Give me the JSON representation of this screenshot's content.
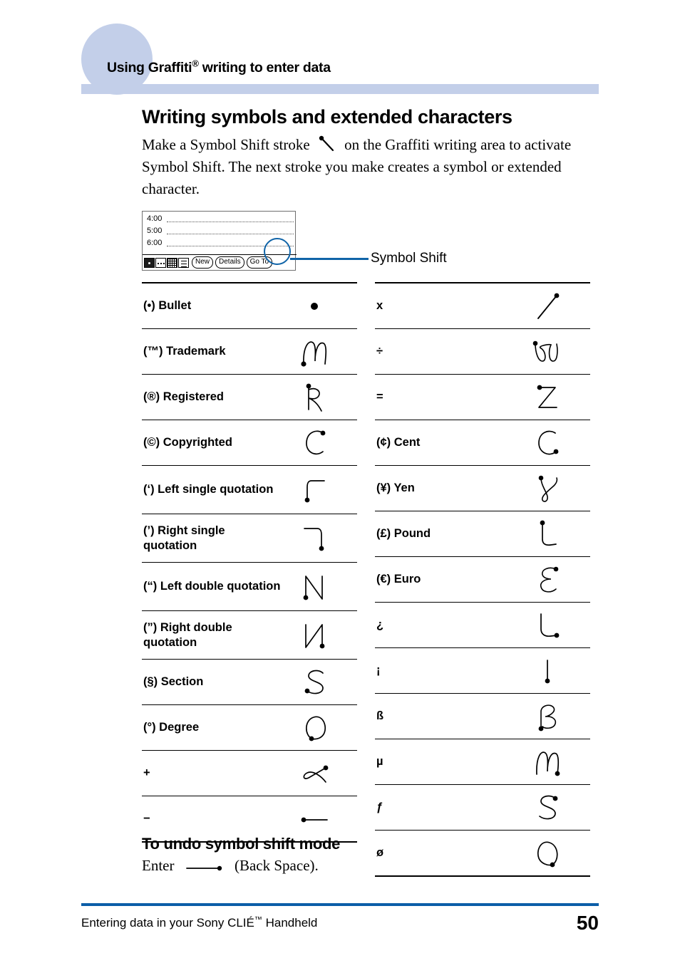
{
  "header": {
    "running_head_prefix": "Using Graffiti",
    "running_head_sup": "®",
    "running_head_suffix": " writing to enter data",
    "bar_color": "#c3cfe9"
  },
  "main": {
    "section_title": "Writing symbols and extended characters",
    "body_part1": "Make a Symbol Shift stroke",
    "body_part2": "on the Graffiti writing area to activate Symbol Shift. The next stroke you make creates a symbol or extended character."
  },
  "figure": {
    "times": [
      "4:00",
      "5:00",
      "6:00"
    ],
    "buttons": [
      "New",
      "Details",
      "Go To"
    ],
    "callout_label": "Symbol Shift",
    "callout_color": "#1064a8"
  },
  "symbol_table": {
    "left_column": [
      {
        "label": "(•) Bullet",
        "stroke": "bullet",
        "lines": 1
      },
      {
        "label": "(™) Trademark",
        "stroke": "trademark-m",
        "lines": 1
      },
      {
        "label": "(®) Registered",
        "stroke": "registered-r",
        "lines": 1
      },
      {
        "label": "(©) Copyrighted",
        "stroke": "copyright-c",
        "lines": 1
      },
      {
        "label": "(‘) Left single quotation",
        "stroke": "left-single-quote",
        "lines": 2
      },
      {
        "label": "(’) Right single quotation",
        "stroke": "right-single-quote",
        "lines": 2
      },
      {
        "label": "(“) Left double quotation",
        "stroke": "left-double-quote",
        "lines": 2
      },
      {
        "label": "(”) Right double quotation",
        "stroke": "right-double-quote",
        "lines": 2
      },
      {
        "label": "(§) Section",
        "stroke": "section-s",
        "lines": 1
      },
      {
        "label": "(°) Degree",
        "stroke": "degree-o",
        "lines": 1
      },
      {
        "label": "+",
        "stroke": "plus-loop",
        "lines": 1
      },
      {
        "label": "−",
        "stroke": "minus-line",
        "lines": 1
      }
    ],
    "right_column": [
      {
        "label": "x",
        "stroke": "times-slash",
        "lines": 1
      },
      {
        "label": "÷",
        "stroke": "divide-w",
        "lines": 1
      },
      {
        "label": "=",
        "stroke": "equals-z",
        "lines": 1
      },
      {
        "label": "(¢) Cent",
        "stroke": "cent-c",
        "lines": 1
      },
      {
        "label": "(¥) Yen",
        "stroke": "yen-y",
        "lines": 1
      },
      {
        "label": "(£) Pound",
        "stroke": "pound-l",
        "lines": 1
      },
      {
        "label": "(€) Euro",
        "stroke": "euro-e",
        "lines": 1
      },
      {
        "label": "¿",
        "stroke": "inv-question-l",
        "lines": 1
      },
      {
        "label": "¡",
        "stroke": "inv-excl-bar",
        "lines": 1
      },
      {
        "label": "ß",
        "stroke": "eszett-b",
        "lines": 1
      },
      {
        "label": "µ",
        "stroke": "mu-m",
        "lines": 1
      },
      {
        "label": "ƒ",
        "stroke": "florin-s",
        "lines": 1
      },
      {
        "label": "ø",
        "stroke": "oslash-o",
        "lines": 1
      }
    ]
  },
  "undo": {
    "title": "To undo symbol shift mode",
    "text_before": "Enter",
    "text_after": "(Back Space)."
  },
  "footer": {
    "text_before": "Entering data in your Sony CLIÉ",
    "text_tm": "™",
    "text_after": " Handheld",
    "page_number": "50",
    "rule_color": "#0b5ea8"
  }
}
